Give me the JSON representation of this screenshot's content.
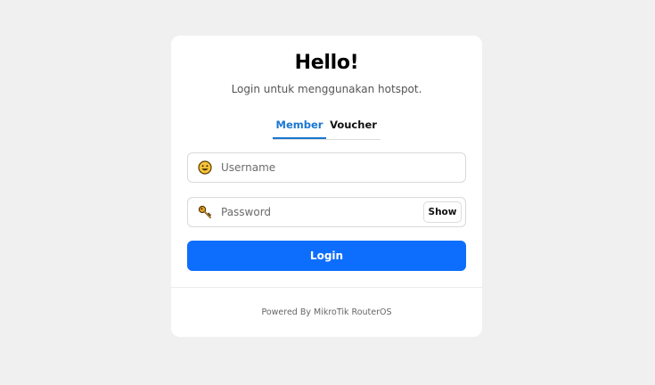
{
  "header": {
    "title": "Hello!",
    "subtitle": "Login untuk menggunakan hotspot."
  },
  "tabs": [
    {
      "label": "Member",
      "active": true
    },
    {
      "label": "Voucher",
      "active": false
    }
  ],
  "form": {
    "username": {
      "placeholder": "Username",
      "value": "",
      "icon": "smiley-icon"
    },
    "password": {
      "placeholder": "Password",
      "value": "",
      "icon": "key-icon"
    },
    "show_label": "Show",
    "login_label": "Login"
  },
  "footer": {
    "text": "Powered By MikroTik RouterOS"
  },
  "colors": {
    "accent": "#1976d2",
    "button": "#0d6efd",
    "background": "#f0f0f0",
    "card": "#ffffff"
  }
}
